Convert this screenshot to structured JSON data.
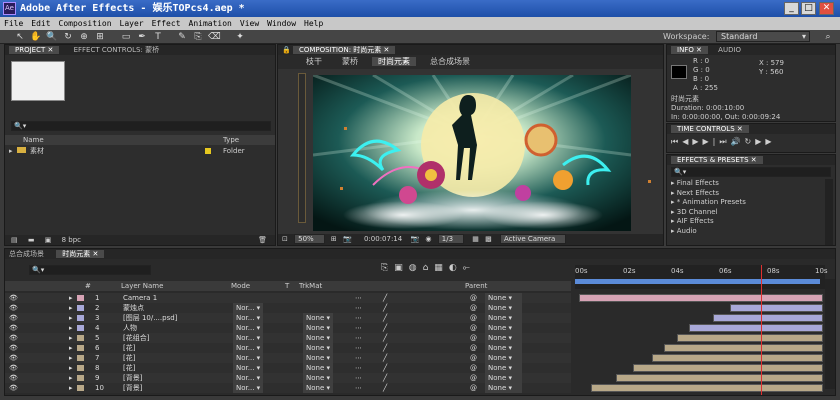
{
  "window": {
    "title": "Adobe After Effects - 娱乐TOPcs4.aep *",
    "min": "_",
    "max": "□",
    "close": "✕",
    "app_icon": "Ae"
  },
  "menu": [
    "File",
    "Edit",
    "Composition",
    "Layer",
    "Effect",
    "Animation",
    "View",
    "Window",
    "Help"
  ],
  "toolbar": {
    "workspace_label": "Workspace:",
    "workspace_value": "Standard"
  },
  "project": {
    "tab_project": "PROJECT ✕",
    "tab_effects": "EFFECT CONTROLS: 蒙桥",
    "search_placeholder": "🔍▾",
    "col_name": "Name",
    "col_type": "Type",
    "item_name": "素材",
    "item_type": "Folder",
    "bpc": "8 bpc"
  },
  "composition": {
    "tab": "COMPOSITION: 时尚元素 ✕",
    "breadcrumbs": [
      "枝干",
      "蒙桥",
      "时尚元素",
      "总合成场景"
    ],
    "zoom": "50%",
    "timecode": "0:00:07:14",
    "resolution": "1/3",
    "camera": "Active Camera"
  },
  "info": {
    "tab_info": "INFO ✕",
    "tab_audio": "AUDIO",
    "r": "R : 0",
    "g": "G : 0",
    "b": "B : 0",
    "a": "A : 255",
    "x": "X : 579",
    "y": "Y : 560",
    "comp_name": "时尚元素",
    "duration": "Duration: 0:00:10:00",
    "in_out": "In: 0:00:00:00, Out: 0:00:09:24"
  },
  "time_controls": {
    "tab": "TIME CONTROLS ✕"
  },
  "effects_presets": {
    "tab": "EFFECTS & PRESETS ✕",
    "search_placeholder": "🔍▾",
    "items": [
      "Final Effects",
      "Next Effects",
      "* Animation Presets",
      "3D Channel",
      "AIF Effects",
      "Audio"
    ]
  },
  "timeline": {
    "tabs": [
      "总合成场景",
      "时尚元素 ✕"
    ],
    "search_placeholder": "🔍▾",
    "headers": {
      "num": "#",
      "layer_name": "Layer Name",
      "mode": "Mode",
      "t": "T",
      "trkmat": "TrkMat",
      "parent": "Parent"
    },
    "ruler": [
      "00s",
      "02s",
      "04s",
      "06s",
      "08s",
      "10s"
    ],
    "layers": [
      {
        "num": "1",
        "name": "Camera 1",
        "mode": "",
        "trkmat": "",
        "parent": "None",
        "color": "#d6a3b5",
        "bar_start": 0.0,
        "bar_end": 1.0
      },
      {
        "num": "2",
        "name": "蒙烛点",
        "mode": "Nor...",
        "trkmat": "",
        "parent": "None",
        "color": "#a8a8d8",
        "bar_start": 0.62,
        "bar_end": 1.0
      },
      {
        "num": "3",
        "name": "[图层 10/....psd]",
        "mode": "Nor...",
        "trkmat": "None",
        "parent": "None",
        "color": "#a8a8d8",
        "bar_start": 0.55,
        "bar_end": 1.0
      },
      {
        "num": "4",
        "name": "人物",
        "mode": "Nor...",
        "trkmat": "None",
        "parent": "None",
        "color": "#a8a8d8",
        "bar_start": 0.45,
        "bar_end": 1.0
      },
      {
        "num": "5",
        "name": "[花组合]",
        "mode": "Nor...",
        "trkmat": "None",
        "parent": "None",
        "color": "#b8a888",
        "bar_start": 0.4,
        "bar_end": 1.0
      },
      {
        "num": "6",
        "name": "[花]",
        "mode": "Nor...",
        "trkmat": "None",
        "parent": "None",
        "color": "#b8a888",
        "bar_start": 0.35,
        "bar_end": 1.0
      },
      {
        "num": "7",
        "name": "[花]",
        "mode": "Nor...",
        "trkmat": "None",
        "parent": "None",
        "color": "#b8a888",
        "bar_start": 0.3,
        "bar_end": 1.0
      },
      {
        "num": "8",
        "name": "[花]",
        "mode": "Nor...",
        "trkmat": "None",
        "parent": "None",
        "color": "#b8a888",
        "bar_start": 0.22,
        "bar_end": 1.0
      },
      {
        "num": "9",
        "name": "[背景]",
        "mode": "Nor...",
        "trkmat": "None",
        "parent": "None",
        "color": "#b8a888",
        "bar_start": 0.15,
        "bar_end": 1.0
      },
      {
        "num": "10",
        "name": "[背景]",
        "mode": "Nor...",
        "trkmat": "None",
        "parent": "None",
        "color": "#b8a888",
        "bar_start": 0.05,
        "bar_end": 1.0
      }
    ]
  },
  "colors": {
    "accent": "#5b8bd8",
    "playhead": "#e03030",
    "titlebar": "#2358b8"
  }
}
